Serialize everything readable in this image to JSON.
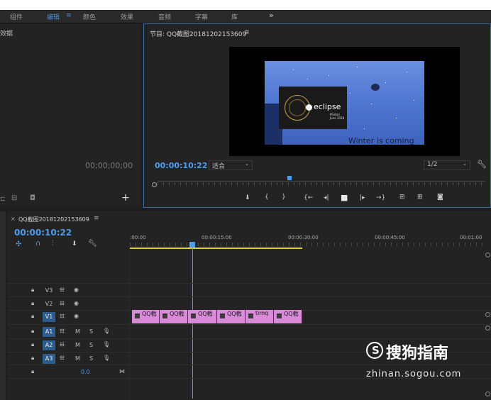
{
  "menu": [
    {
      "label": "组件",
      "active": false
    },
    {
      "label": "编辑",
      "active": true
    },
    {
      "label": "≡",
      "active": true
    },
    {
      "label": "颜色",
      "active": false
    },
    {
      "label": "效果",
      "active": false
    },
    {
      "label": "音频",
      "active": false
    },
    {
      "label": "字幕",
      "active": false
    },
    {
      "label": "库",
      "active": false
    },
    {
      "label": "»",
      "active": false
    }
  ],
  "source": {
    "title": "效据",
    "timecode": "00;00;00;00",
    "add_label": "+"
  },
  "program": {
    "title": "节目: QQ截图20181202153609",
    "menu_icon": "≡",
    "timecode": "00:00:10:22",
    "fit_label": "适合",
    "resolution": "1/2",
    "video_text": "Winter is coming",
    "eclipse_text": "eclipse",
    "eclipse_sub": "Photon",
    "eclipse_sub2": "June 2018"
  },
  "timeline": {
    "tab_close": "×",
    "tab_label": "QQ截图20181202153609",
    "tab_menu": "≡",
    "timecode": "00:00:10:22",
    "ruler": [
      ":00:00",
      "00:00:15:00",
      "00:00:30:00",
      "00:00:45:00",
      "00:01:00"
    ],
    "tracks": [
      {
        "label": "V3",
        "selected": false
      },
      {
        "label": "V2",
        "selected": false
      },
      {
        "label": "V1",
        "selected": true
      },
      {
        "label": "A1",
        "selected": true
      },
      {
        "label": "A2",
        "selected": true
      },
      {
        "label": "A3",
        "selected": true
      }
    ],
    "audio_m": "M",
    "audio_s": "S",
    "master_value": "0.0",
    "clips": [
      "QQ截",
      "QQ截",
      "QQ截",
      "QQ截",
      "timq",
      "QQ截"
    ]
  },
  "watermark": {
    "brand": "搜狗指南",
    "url": "zhinan.sogou.com"
  }
}
